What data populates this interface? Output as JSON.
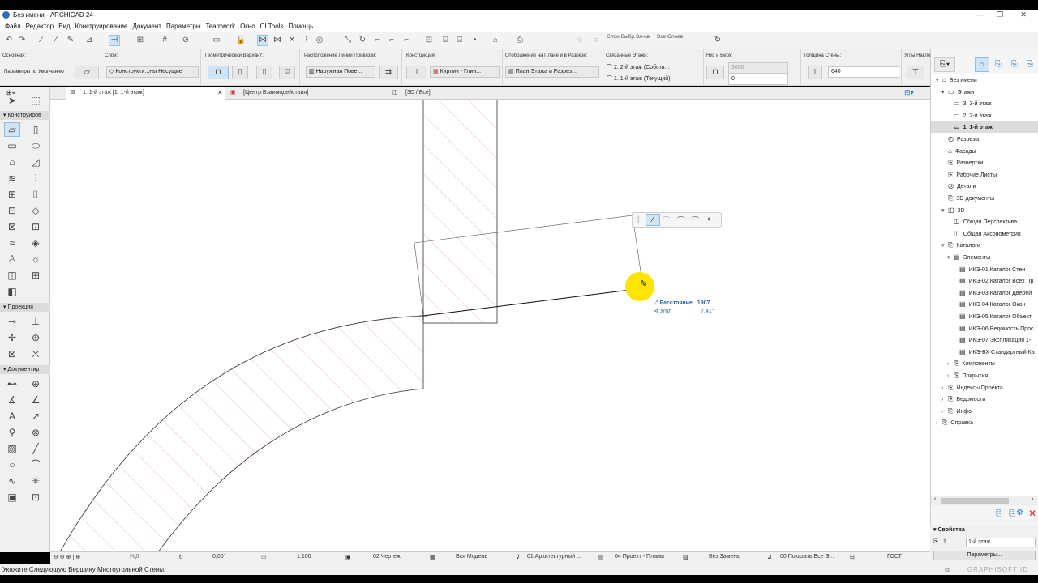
{
  "window": {
    "title": "Без имени - ARCHICAD 24",
    "controls": [
      "—",
      "❐",
      "✕"
    ]
  },
  "menu": [
    "Файл",
    "Редактор",
    "Вид",
    "Конструирование",
    "Документ",
    "Параметры",
    "Teamwork",
    "Окно",
    "CI Tools",
    "Помощь"
  ],
  "toolbar1": {
    "layer_sets_label": "Слои Выбр.Эл-ов",
    "all_layers_label": "Все Слоев:"
  },
  "info_box": {
    "basic": {
      "label": "Основная:",
      "value": "Параметры по Умолчанию"
    },
    "layer": {
      "label": "Слой:",
      "value": "Конструкти...ны Несущие"
    },
    "geometry": {
      "label": "Геометрический Вариант:"
    },
    "ref_line": {
      "label": "Расположение Линии Привязки:",
      "value": "Наружная Пове..."
    },
    "structure": {
      "label": "Конструкция:",
      "value": "Кирпич - Глин..."
    },
    "floor_plan": {
      "label": "Отображение на Плане и в Разрезе:",
      "value": "План Этажа и Разрез..."
    },
    "linked_stories": {
      "label": "Связанные Этажи:",
      "top": "2. 2-й этаж (Собств...",
      "bottom": "1. 1-й этаж (Текущий)"
    },
    "height": {
      "label": "Низ и Верх:",
      "top": "3000",
      "bottom": "0"
    },
    "thickness": {
      "label": "Толщина Стены:",
      "value": "640"
    },
    "angle": {
      "label": "Углы Накло"
    }
  },
  "tabs": [
    {
      "label": "1. 1-й этаж [1. 1-й этаж]"
    },
    {
      "label": "[Центр Взаимодействия]"
    },
    {
      "label": "[3D / Все]"
    }
  ],
  "toolbox": {
    "sections": [
      "Конструиров",
      "Проекция",
      "Документир"
    ]
  },
  "canvas": {
    "tracker": {
      "distance_label": "Расстояние",
      "distance_value": "1907",
      "angle_label": "Угол",
      "angle_value": "7,41°"
    }
  },
  "navigator": {
    "items": [
      {
        "label": "Без имени",
        "level": 0,
        "arrow": "▾"
      },
      {
        "label": "Этажи",
        "level": 1,
        "arrow": "▾"
      },
      {
        "label": "3. 3-й этаж",
        "level": 2,
        "arrow": ""
      },
      {
        "label": "2. 2-й этаж",
        "level": 2,
        "arrow": ""
      },
      {
        "label": "1. 1-й этаж",
        "level": 2,
        "arrow": "",
        "selected": true
      },
      {
        "label": "Разрезы",
        "level": 1,
        "arrow": ""
      },
      {
        "label": "Фасады",
        "level": 1,
        "arrow": ""
      },
      {
        "label": "Развертки",
        "level": 1,
        "arrow": ""
      },
      {
        "label": "Рабочие Листы",
        "level": 1,
        "arrow": ""
      },
      {
        "label": "Детали",
        "level": 1,
        "arrow": ""
      },
      {
        "label": "3D-документы",
        "level": 1,
        "arrow": ""
      },
      {
        "label": "3D",
        "level": 1,
        "arrow": "▾"
      },
      {
        "label": "Общая Перспектива",
        "level": 2,
        "arrow": ""
      },
      {
        "label": "Общая Аксонометрия",
        "level": 2,
        "arrow": ""
      },
      {
        "label": "Каталоги",
        "level": 1,
        "arrow": "▾"
      },
      {
        "label": "Элементы",
        "level": 2,
        "arrow": "▾"
      },
      {
        "label": "ИКЭ-01 Каталог Стен",
        "level": 3,
        "arrow": ""
      },
      {
        "label": "ИКЭ-02 Каталог Всех Пр",
        "level": 3,
        "arrow": ""
      },
      {
        "label": "ИКЭ-03 Каталог Дверей",
        "level": 3,
        "arrow": ""
      },
      {
        "label": "ИКЭ-04 Каталог Окон",
        "level": 3,
        "arrow": ""
      },
      {
        "label": "ИКЭ-05 Каталог Объект",
        "level": 3,
        "arrow": ""
      },
      {
        "label": "ИКЭ-06 Ведомость Прос",
        "level": 3,
        "arrow": ""
      },
      {
        "label": "ИКЭ-07 Экспликация 1-",
        "level": 3,
        "arrow": ""
      },
      {
        "label": "ИКЭ-ВХ Стандартный Ка",
        "level": 3,
        "arrow": ""
      },
      {
        "label": "Компоненты",
        "level": 2,
        "arrow": "›"
      },
      {
        "label": "Покрытия",
        "level": 2,
        "arrow": "›"
      },
      {
        "label": "Индексы Проекта",
        "level": 1,
        "arrow": "›"
      },
      {
        "label": "Ведомости",
        "level": 1,
        "arrow": "›"
      },
      {
        "label": "Инфо",
        "level": 1,
        "arrow": "›"
      },
      {
        "label": "Справка",
        "level": 0,
        "arrow": "›"
      }
    ]
  },
  "properties": {
    "title": "Свойства",
    "id": "1.",
    "story": "1-й этаж",
    "button": "Параметры..."
  },
  "statusbar": {
    "na": "Н/Д",
    "angle": "0,00°",
    "scale": "1:100",
    "penset": "02 Чертеж",
    "model": "Вся Модель",
    "layer_combo": "01 Архитектурный ...",
    "mvo": "04 Проект - Планы",
    "renovation": "Без Замены",
    "filter": "00 Показать Все Э...",
    "dims": "ГОСТ"
  },
  "hint": "Укажите Следующую Вершину Многоугольной Стены.",
  "brand": "GRAPHISOFT ID"
}
